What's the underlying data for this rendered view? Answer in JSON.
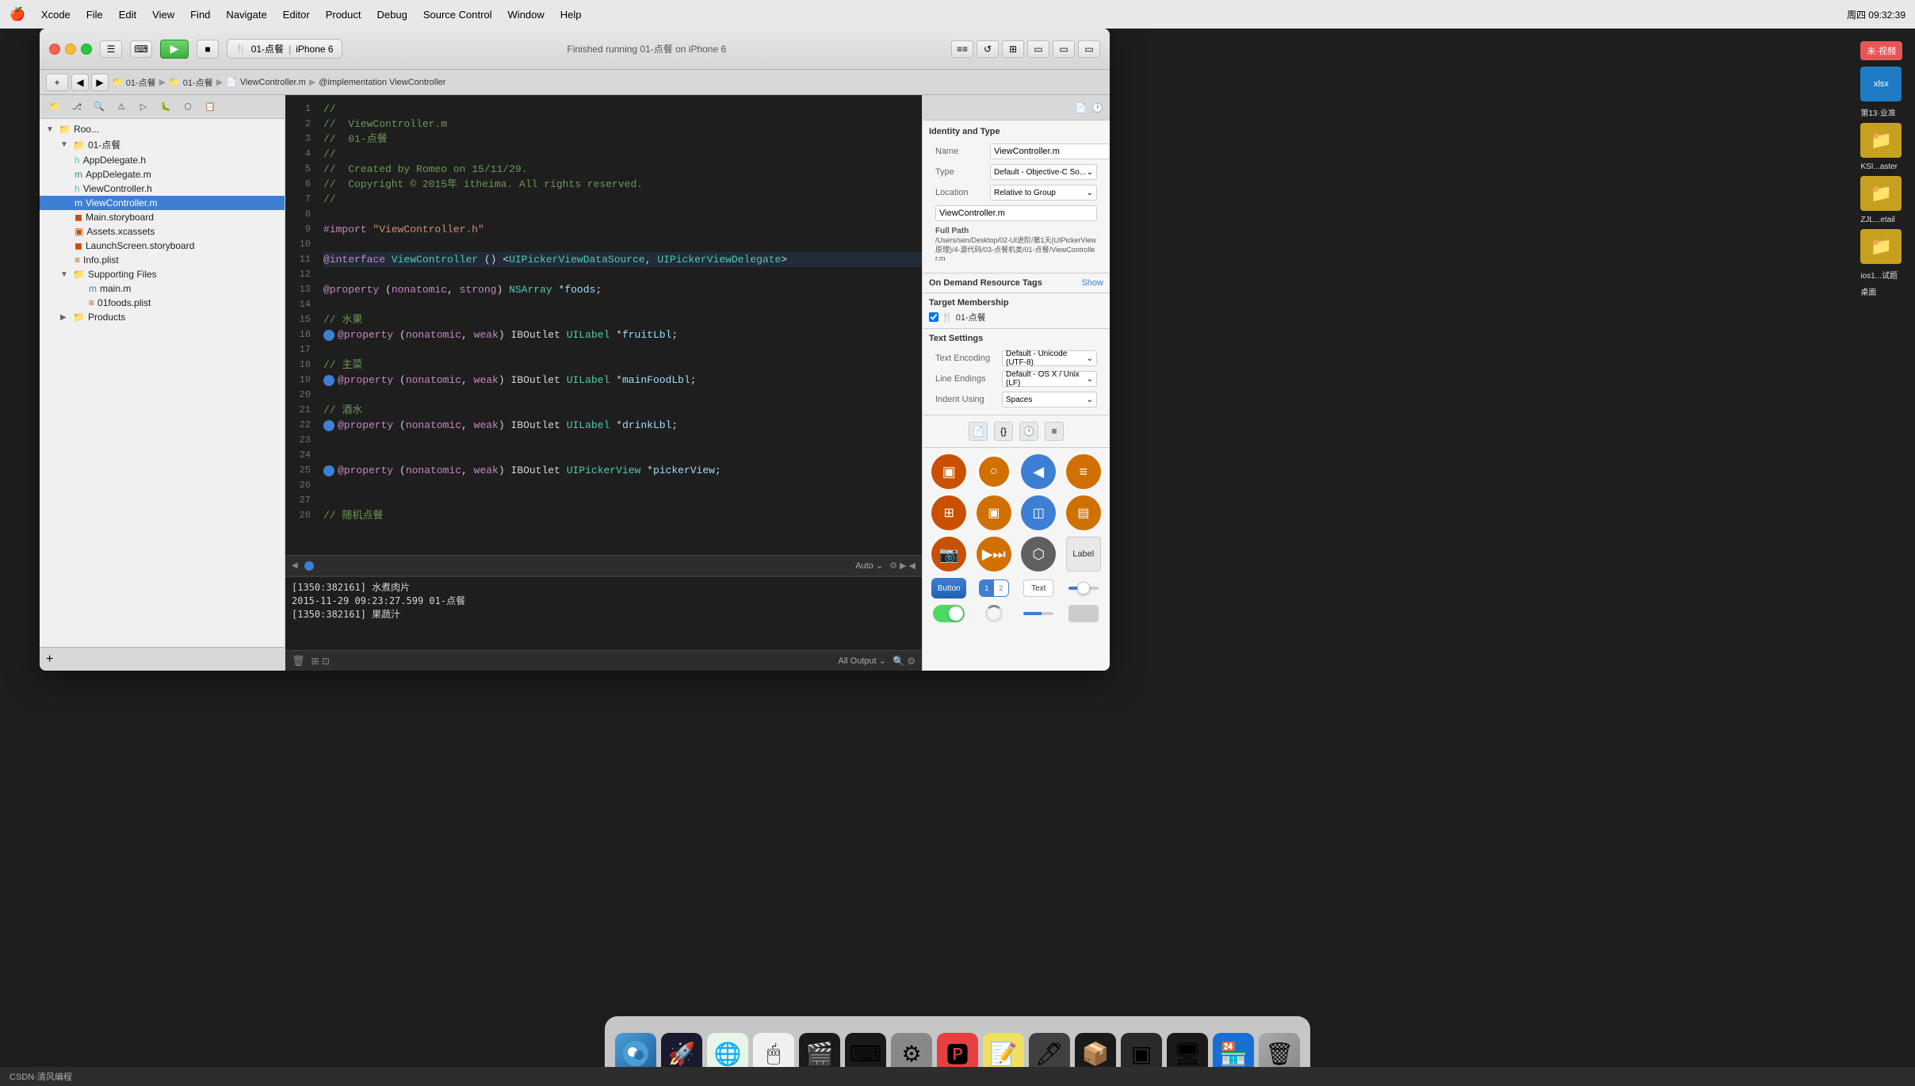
{
  "menubar": {
    "apple": "🍎",
    "items": [
      "Xcode",
      "File",
      "Edit",
      "View",
      "Find",
      "Navigate",
      "Editor",
      "Product",
      "Debug",
      "Source Control",
      "Window",
      "Help"
    ],
    "right": "周四 09:32:39"
  },
  "titlebar": {
    "scheme": "01-点餐",
    "device": "iPhone 6",
    "status": "Finished running 01-点餐 on iPhone 6"
  },
  "breadcrumb": {
    "parts": [
      "01-点餐",
      "01-点餐",
      "ViewController.m",
      "@implementation ViewController"
    ]
  },
  "sidebar": {
    "title": "Root",
    "items": [
      {
        "label": "01-点餐",
        "level": 1,
        "type": "group",
        "expanded": true
      },
      {
        "label": "AppDelegate.h",
        "level": 2,
        "type": "file"
      },
      {
        "label": "AppDelegate.m",
        "level": 2,
        "type": "file"
      },
      {
        "label": "ViewController.h",
        "level": 2,
        "type": "file"
      },
      {
        "label": "ViewController.m",
        "level": 2,
        "type": "file",
        "selected": true
      },
      {
        "label": "Main.storyboard",
        "level": 2,
        "type": "storyboard"
      },
      {
        "label": "Assets.xcassets",
        "level": 2,
        "type": "assets"
      },
      {
        "label": "LaunchScreen.storyboard",
        "level": 2,
        "type": "storyboard"
      },
      {
        "label": "Info.plist",
        "level": 2,
        "type": "plist"
      },
      {
        "label": "Supporting Files",
        "level": 2,
        "type": "group",
        "expanded": true
      },
      {
        "label": "main.m",
        "level": 3,
        "type": "file"
      },
      {
        "label": "01foods.plist",
        "level": 3,
        "type": "plist"
      },
      {
        "label": "Products",
        "level": 1,
        "type": "group"
      }
    ]
  },
  "code": {
    "lines": [
      {
        "num": 1,
        "content": "//",
        "type": "comment"
      },
      {
        "num": 2,
        "content": "//  ViewController.m",
        "type": "comment"
      },
      {
        "num": 3,
        "content": "//  01-点餐",
        "type": "comment"
      },
      {
        "num": 4,
        "content": "//",
        "type": "comment"
      },
      {
        "num": 5,
        "content": "//  Created by Romeo on 15/11/29.",
        "type": "comment"
      },
      {
        "num": 6,
        "content": "//  Copyright © 2015年 itheima. All rights reserved.",
        "type": "comment"
      },
      {
        "num": 7,
        "content": "//",
        "type": "comment"
      },
      {
        "num": 8,
        "content": "",
        "type": "empty"
      },
      {
        "num": 9,
        "content": "#import \"ViewController.h\"",
        "type": "import"
      },
      {
        "num": 10,
        "content": "",
        "type": "empty"
      },
      {
        "num": 11,
        "content": "@interface ViewController () <UIPickerViewDataSource, UIPickerViewDelegate>",
        "type": "code"
      },
      {
        "num": 12,
        "content": "",
        "type": "empty"
      },
      {
        "num": 13,
        "content": "@property (nonatomic, strong) NSArray *foods;",
        "type": "code"
      },
      {
        "num": 14,
        "content": "",
        "type": "empty"
      },
      {
        "num": 15,
        "content": "// 水果",
        "type": "comment"
      },
      {
        "num": 16,
        "content": "@property (nonatomic, weak) IBOutlet UILabel *fruitLbl;",
        "type": "code",
        "breakpoint": true
      },
      {
        "num": 17,
        "content": "",
        "type": "empty"
      },
      {
        "num": 18,
        "content": "// 主菜",
        "type": "comment"
      },
      {
        "num": 19,
        "content": "@property (nonatomic, weak) IBOutlet UILabel *mainFoodLbl;",
        "type": "code",
        "breakpoint": true
      },
      {
        "num": 20,
        "content": "",
        "type": "empty"
      },
      {
        "num": 21,
        "content": "// 酒水",
        "type": "comment"
      },
      {
        "num": 22,
        "content": "@property (nonatomic, weak) IBOutlet UILabel *drinkLbl;",
        "type": "code",
        "breakpoint": true
      },
      {
        "num": 23,
        "content": "",
        "type": "empty"
      },
      {
        "num": 24,
        "content": "",
        "type": "empty"
      },
      {
        "num": 25,
        "content": "@property (nonatomic, weak) IBOutlet UIPickerView *pickerView;",
        "type": "code",
        "breakpoint": true
      },
      {
        "num": 26,
        "content": "",
        "type": "empty"
      },
      {
        "num": 27,
        "content": "",
        "type": "empty"
      },
      {
        "num": 28,
        "content": "// 随机点餐",
        "type": "comment"
      }
    ]
  },
  "console": {
    "lines": [
      "[1350:382161] 水煮肉片",
      "2015-11-29 09:23:27.599 01-点餐",
      "[1350:382161] 果蔬汁"
    ]
  },
  "inspector": {
    "title": "Identity and Type",
    "name_label": "Name",
    "name_value": "ViewController.m",
    "type_label": "Type",
    "type_value": "Default - Objective-C So...",
    "location_label": "Location",
    "location_value": "Relative to Group",
    "filename_value": "ViewController.m",
    "full_path_label": "Full Path",
    "full_path_value": "/Users/sen/Desktop/02-UI进阶/第1天(UIPickerView原理)/4-源代码/03-点餐机类/01-点餐/ViewController.m",
    "od_title": "On Demand Resource Tags",
    "show_label": "Show",
    "target_title": "Target Membership",
    "target_value": "01-点餐",
    "text_settings_title": "Text Settings",
    "encoding_label": "Text Encoding",
    "encoding_value": "Default - Unicode (UTF-8)",
    "line_endings_label": "Line Endings",
    "line_endings_value": "Default - OS X / Unix (LF)",
    "indent_label": "Indent Using",
    "indent_value": "Spaces"
  },
  "object_library": {
    "rows": [
      [
        {
          "icon": "🟧",
          "color": "#c85000",
          "label": ""
        },
        {
          "icon": "⬜",
          "color": "#d06010",
          "label": ""
        },
        {
          "icon": "◀",
          "color": "#3d7fd4",
          "label": ""
        },
        {
          "icon": "≡",
          "color": "#d06010",
          "label": ""
        }
      ],
      [
        {
          "icon": "⊞",
          "color": "#c85000",
          "label": ""
        },
        {
          "icon": "▣",
          "color": "#d06010",
          "label": ""
        },
        {
          "icon": "▣",
          "color": "#3d7fd4",
          "label": ""
        },
        {
          "icon": "▣",
          "color": "#d06010",
          "label": ""
        }
      ],
      [
        {
          "icon": "📷",
          "color": "#c85000",
          "label": ""
        },
        {
          "icon": "⏭",
          "color": "#d06010",
          "label": ""
        },
        {
          "icon": "🎲",
          "color": "#7a7a7a",
          "label": ""
        },
        {
          "icon": "Label",
          "color": "transparent",
          "label": ""
        }
      ],
      [
        {
          "icon": "Button",
          "label": "Button"
        },
        {
          "icon": "1 2",
          "label": ""
        },
        {
          "icon": "Text",
          "label": "Text"
        },
        {
          "icon": "slider",
          "label": ""
        }
      ],
      [
        {
          "icon": "toggle",
          "label": ""
        },
        {
          "icon": "spinner",
          "label": ""
        },
        {
          "icon": "slider2",
          "label": ""
        },
        {
          "icon": "gray",
          "label": ""
        }
      ]
    ],
    "ksi_label": "KSI...aster",
    "zjl_label": "ZJL...etail",
    "ios_label": "ios1...试题"
  },
  "bottom_status": {
    "left": "Auto",
    "right": "All Output"
  },
  "dock_items": [
    "🔍",
    "🚀",
    "🌐",
    "🖱",
    "🎬",
    "🔧",
    "⚙",
    "🅿",
    "📝",
    "🖊",
    "📦",
    "🗑"
  ],
  "screen_bottom": "CSDN·清风编程"
}
